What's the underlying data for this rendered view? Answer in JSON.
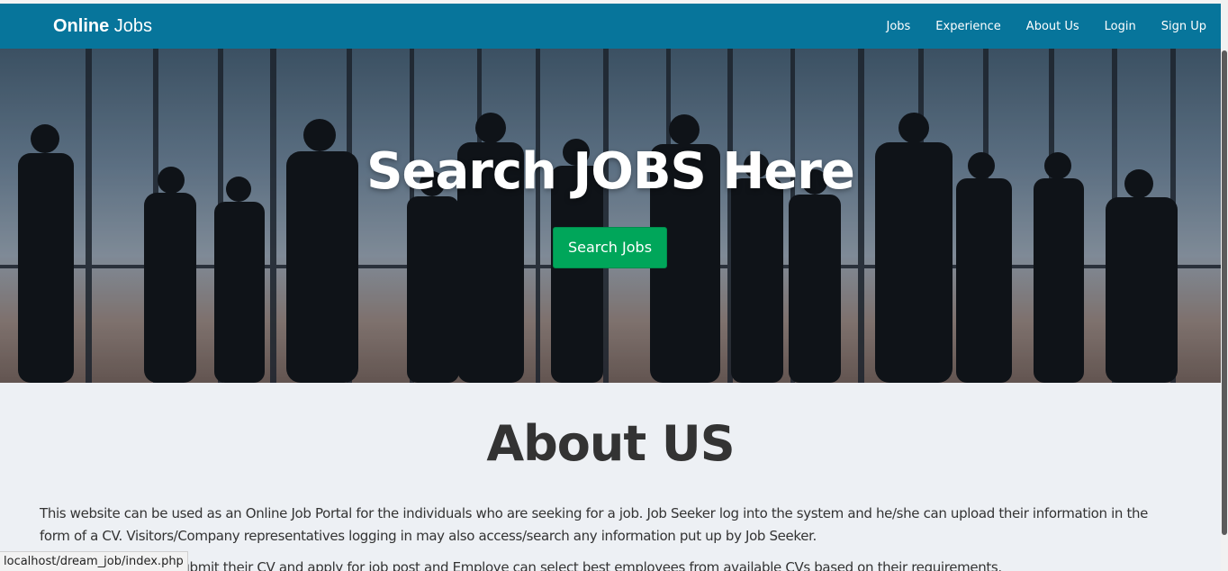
{
  "brand": {
    "bold": "Online",
    "light": "Jobs"
  },
  "nav": [
    {
      "label": "Jobs"
    },
    {
      "label": "Experience"
    },
    {
      "label": "About Us"
    },
    {
      "label": "Login"
    },
    {
      "label": "Sign Up"
    }
  ],
  "hero": {
    "title_before": "Search ",
    "title_bold": "JOBS",
    "title_after": " Here",
    "button_label": "Search Jobs"
  },
  "about": {
    "title": "About US",
    "paragraph_1": "This website can be used as an Online Job Portal for the individuals who are seeking for a job. Job Seeker log into the system and he/she can upload their information in the form of a CV. Visitors/Company representatives logging in may also access/search any information put up by Job Seeker.",
    "paragraph_2": "Job Seeker is able to submit their CV and apply for job post and Employe can select best employees from available CVs based on their requirements."
  },
  "status_bar": {
    "url": "localhost/dream_job/index.php"
  },
  "colors": {
    "navbar": "#07759b",
    "button": "#00a65a",
    "background": "#edf0f4"
  }
}
